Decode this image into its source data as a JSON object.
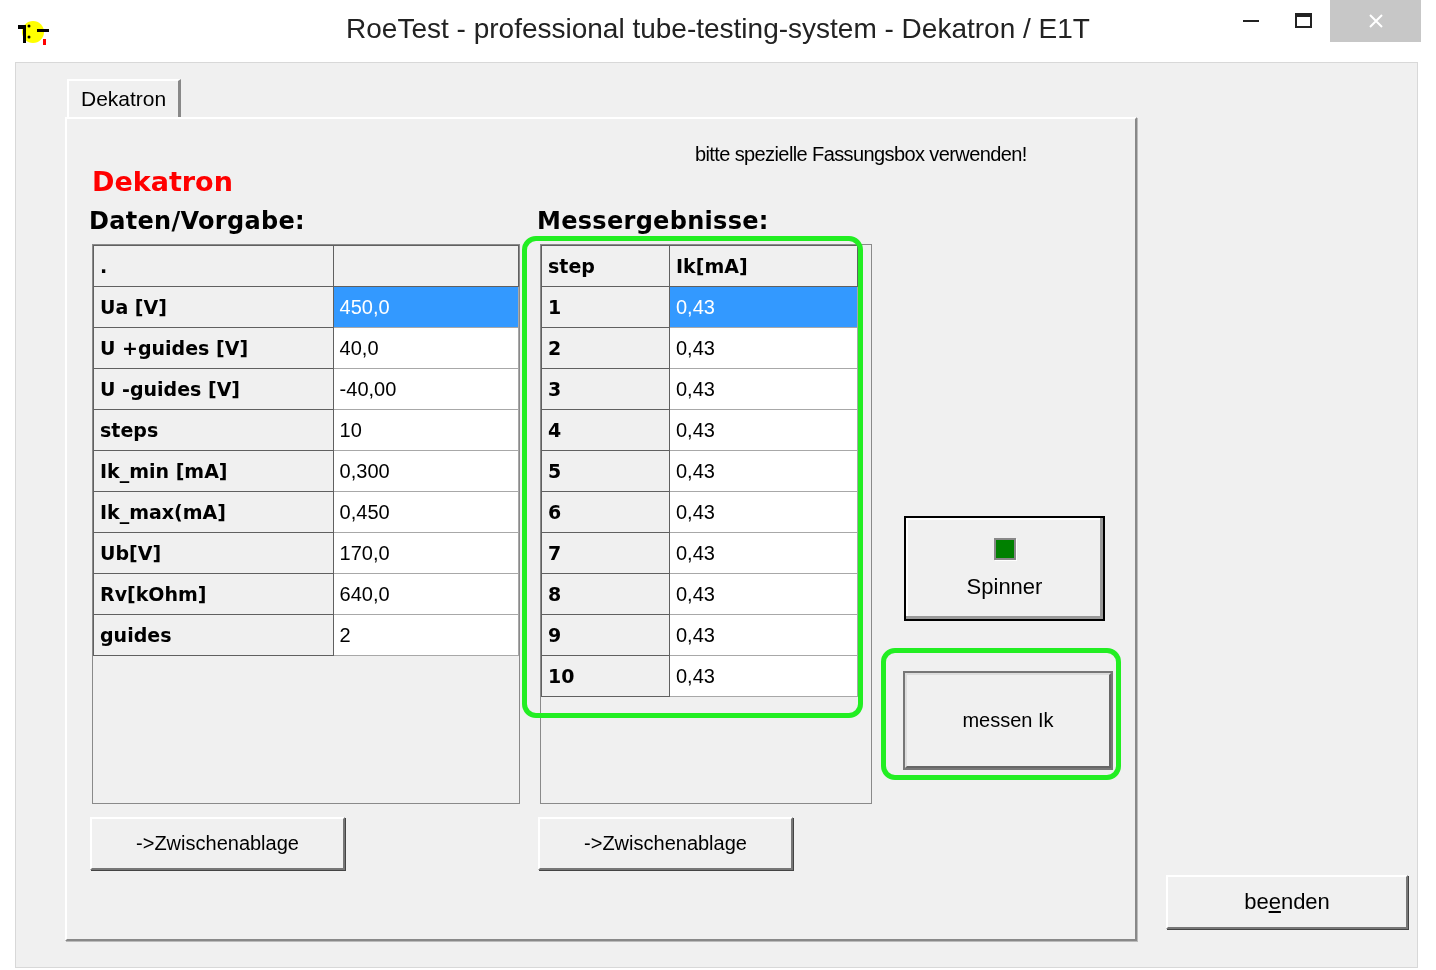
{
  "window": {
    "title": "RoeTest - professional tube-testing-system - Dekatron / E1T"
  },
  "tabs": [
    {
      "label": "Dekatron",
      "selected": true
    }
  ],
  "heading": "Dekatron",
  "notice": "bitte spezielle Fassungsbox verwenden!",
  "data_table": {
    "title": "Daten/Vorgabe:",
    "columns": [
      "."
    ],
    "rows": [
      {
        "label": "Ua [V]",
        "value": "450,0",
        "selected": true
      },
      {
        "label": "U +guides [V]",
        "value": "40,0",
        "selected": false
      },
      {
        "label": "U -guides [V]",
        "value": "-40,00",
        "selected": false
      },
      {
        "label": "steps",
        "value": "10",
        "selected": false
      },
      {
        "label": "Ik_min [mA]",
        "value": "0,300",
        "selected": false
      },
      {
        "label": "Ik_max(mA]",
        "value": "0,450",
        "selected": false
      },
      {
        "label": "Ub[V]",
        "value": "170,0",
        "selected": false
      },
      {
        "label": "Rv[kOhm]",
        "value": "640,0",
        "selected": false
      },
      {
        "label": "guides",
        "value": "2",
        "selected": false
      }
    ],
    "copy_button": "->Zwischenablage"
  },
  "results_table": {
    "title": "Messergebnisse:",
    "columns": [
      "step",
      "Ik[mA]"
    ],
    "rows": [
      {
        "step": "1",
        "value": "0,43",
        "selected": true
      },
      {
        "step": "2",
        "value": "0,43",
        "selected": false
      },
      {
        "step": "3",
        "value": "0,43",
        "selected": false
      },
      {
        "step": "4",
        "value": "0,43",
        "selected": false
      },
      {
        "step": "5",
        "value": "0,43",
        "selected": false
      },
      {
        "step": "6",
        "value": "0,43",
        "selected": false
      },
      {
        "step": "7",
        "value": "0,43",
        "selected": false
      },
      {
        "step": "8",
        "value": "0,43",
        "selected": false
      },
      {
        "step": "9",
        "value": "0,43",
        "selected": false
      },
      {
        "step": "10",
        "value": "0,43",
        "selected": false
      }
    ],
    "copy_button": "->Zwischenablage"
  },
  "spinner": {
    "label": "Spinner",
    "on": true
  },
  "measure_button": {
    "label": "messen Ik"
  },
  "exit_button": {
    "label_before": "be",
    "access_key": "e",
    "label_after": "nden"
  }
}
